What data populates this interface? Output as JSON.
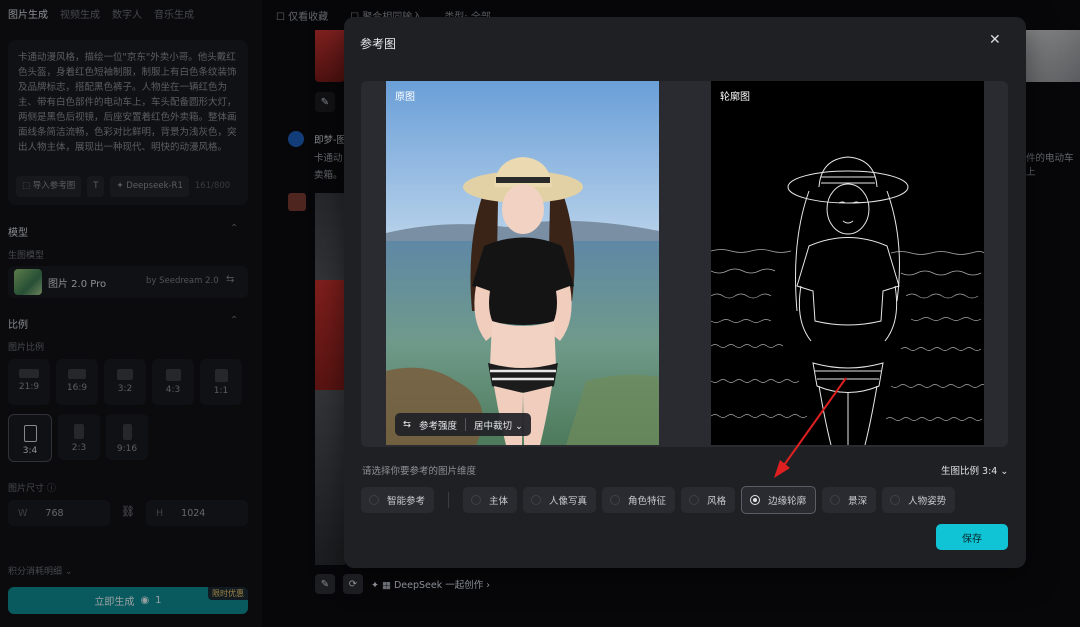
{
  "sidebar": {
    "tabs": [
      "图片生成",
      "视频生成",
      "数字人",
      "音乐生成"
    ],
    "prompt": "卡通动漫风格，描绘一位\"京东\"外卖小哥。他头戴红色头盔，身着红色短袖制服，制服上有白色条纹装饰及品牌标志，搭配黑色裤子。人物坐在一辆红色为主、带有白色部件的电动车上，车头配备圆形大灯，两侧是黑色后视镜，后座安置着红色外卖箱。整体画面线条简洁流畅，色彩对比鲜明，背景为浅灰色，突出人物主体，展现出一种现代、明快的动漫风格。",
    "import_ref": "导入参考图",
    "deepseek": "Deepseek-R1",
    "char_count": "161/800",
    "model_section": "模型",
    "model_sub": "生图模型",
    "model_name": "图片 2.0 Pro",
    "model_by": "by Seedream 2.0",
    "ratio_section": "比例",
    "ratio_sub": "图片比例",
    "ratios_row1": [
      "21:9",
      "16:9",
      "3:2",
      "4:3",
      "1:1"
    ],
    "ratios_row2": [
      "3:4",
      "2:3",
      "9:16"
    ],
    "size_label": "图片尺寸",
    "width_label": "W",
    "width_value": "768",
    "height_label": "H",
    "height_value": "1024",
    "points_detail": "积分消耗明细",
    "generate": "立即生成",
    "generate_cost": "1",
    "promo": "限时优惠"
  },
  "topbar": {
    "favorites": "仅看收藏",
    "aggregate": "聚合相同输入",
    "type": "类型: 全部"
  },
  "feed": {
    "author": "即梦-图",
    "text_left": "卡通动",
    "text_left2": "卖箱。",
    "text_right": "件的电动车上",
    "deepseek_cta": "DeepSeek 一起创作"
  },
  "modal": {
    "title": "参考图",
    "original_label": "原图",
    "edge_label": "轮廓图",
    "strength": "参考强度",
    "crop": "居中裁切",
    "hint": "请选择你要参考的图片维度",
    "ratio": "生图比例 3:4",
    "options": [
      "智能参考",
      "主体",
      "人像写真",
      "角色特征",
      "风格",
      "边缘轮廓",
      "景深",
      "人物姿势"
    ],
    "selected_option": "边缘轮廓",
    "save": "保存"
  },
  "colors": {
    "accent": "#10c4d6",
    "generate_button": "#0e8a93",
    "arrow": "#e02020"
  }
}
